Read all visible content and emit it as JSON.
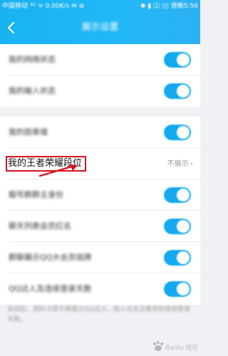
{
  "status_bar": {
    "left_text": "中国移动  ⁴ᴳ  ᯤ  0.00K/s  ✉  ⊚",
    "right_text": "✱ ▮ ⑴ ▯▯ 傍晚5:56"
  },
  "header": {
    "title": "展示设置"
  },
  "section1": {
    "items": [
      {
        "label": "我的网络状态",
        "toggle_on": true
      },
      {
        "label": "我的输入状态",
        "toggle_on": true
      }
    ]
  },
  "section2": {
    "items": [
      {
        "label": "我的勋章墙",
        "toggle_on": true
      },
      {
        "label": "我的王者荣耀段位",
        "value": "不展示",
        "chevron": "›"
      },
      {
        "label": "靓号群群主身份",
        "toggle_on": true
      },
      {
        "label": "聊天列表会员红名",
        "toggle_on": true
      },
      {
        "label": "群聊展示QQ大会员铭牌",
        "toggle_on": true
      },
      {
        "label": "QQ达人及连续登录天数",
        "toggle_on": true
      }
    ]
  },
  "footnote": "关闭后，资料卡将不再展示QQ达人，他人也无法看到你连续登录天数。",
  "watermark_text": "Baidu 经验",
  "colors": {
    "header_blue": "#22b7f6",
    "toggle_blue": "#14a9ef",
    "highlight_red": "#d6111f",
    "background": "#f0f1f5"
  }
}
